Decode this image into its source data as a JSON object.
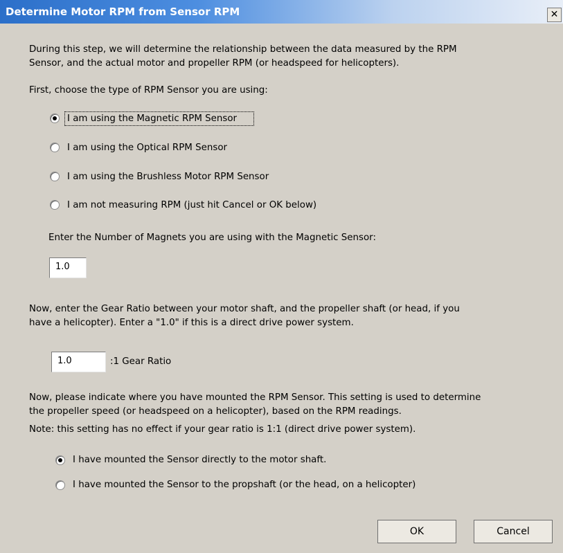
{
  "window": {
    "title": "Determine Motor RPM from Sensor RPM",
    "close_label": "✕"
  },
  "intro": {
    "line1": "During this step, we will determine the relationship between the data measured by the RPM",
    "line2": "Sensor, and the actual motor and propeller RPM (or headspeed for helicopters)."
  },
  "sensor_type": {
    "prompt": "First, choose the type of RPM Sensor you are using:",
    "options": [
      "I am using the Magnetic RPM Sensor",
      "I am using the Optical RPM Sensor",
      "I am using the Brushless Motor RPM Sensor",
      "I am not measuring RPM (just hit Cancel or OK below)"
    ],
    "selected": "I am using the Magnetic RPM Sensor"
  },
  "magnets": {
    "prompt": "Enter the Number of Magnets you are using with the Magnetic Sensor:",
    "value": "1.0"
  },
  "gear": {
    "line1": "Now, enter the Gear Ratio between your motor shaft, and the propeller shaft (or head, if you",
    "line2": "have a helicopter).    Enter a \"1.0\" if this is a direct drive power system.",
    "value": "1.0",
    "suffix": ":1 Gear Ratio"
  },
  "mount": {
    "line1": "Now, please indicate where you have mounted the RPM Sensor.   This setting is used to determine",
    "line2": "the propeller speed (or headspeed on a helicopter), based on the RPM readings.",
    "note": "Note: this setting has no effect if your gear ratio is 1:1 (direct drive power system).",
    "options": [
      "I have mounted the Sensor directly to the motor shaft.",
      "I have mounted the Sensor to the propshaft (or the head, on a helicopter)"
    ],
    "selected": "I have mounted the Sensor directly to the motor shaft."
  },
  "buttons": {
    "ok": "OK",
    "cancel": "Cancel"
  }
}
